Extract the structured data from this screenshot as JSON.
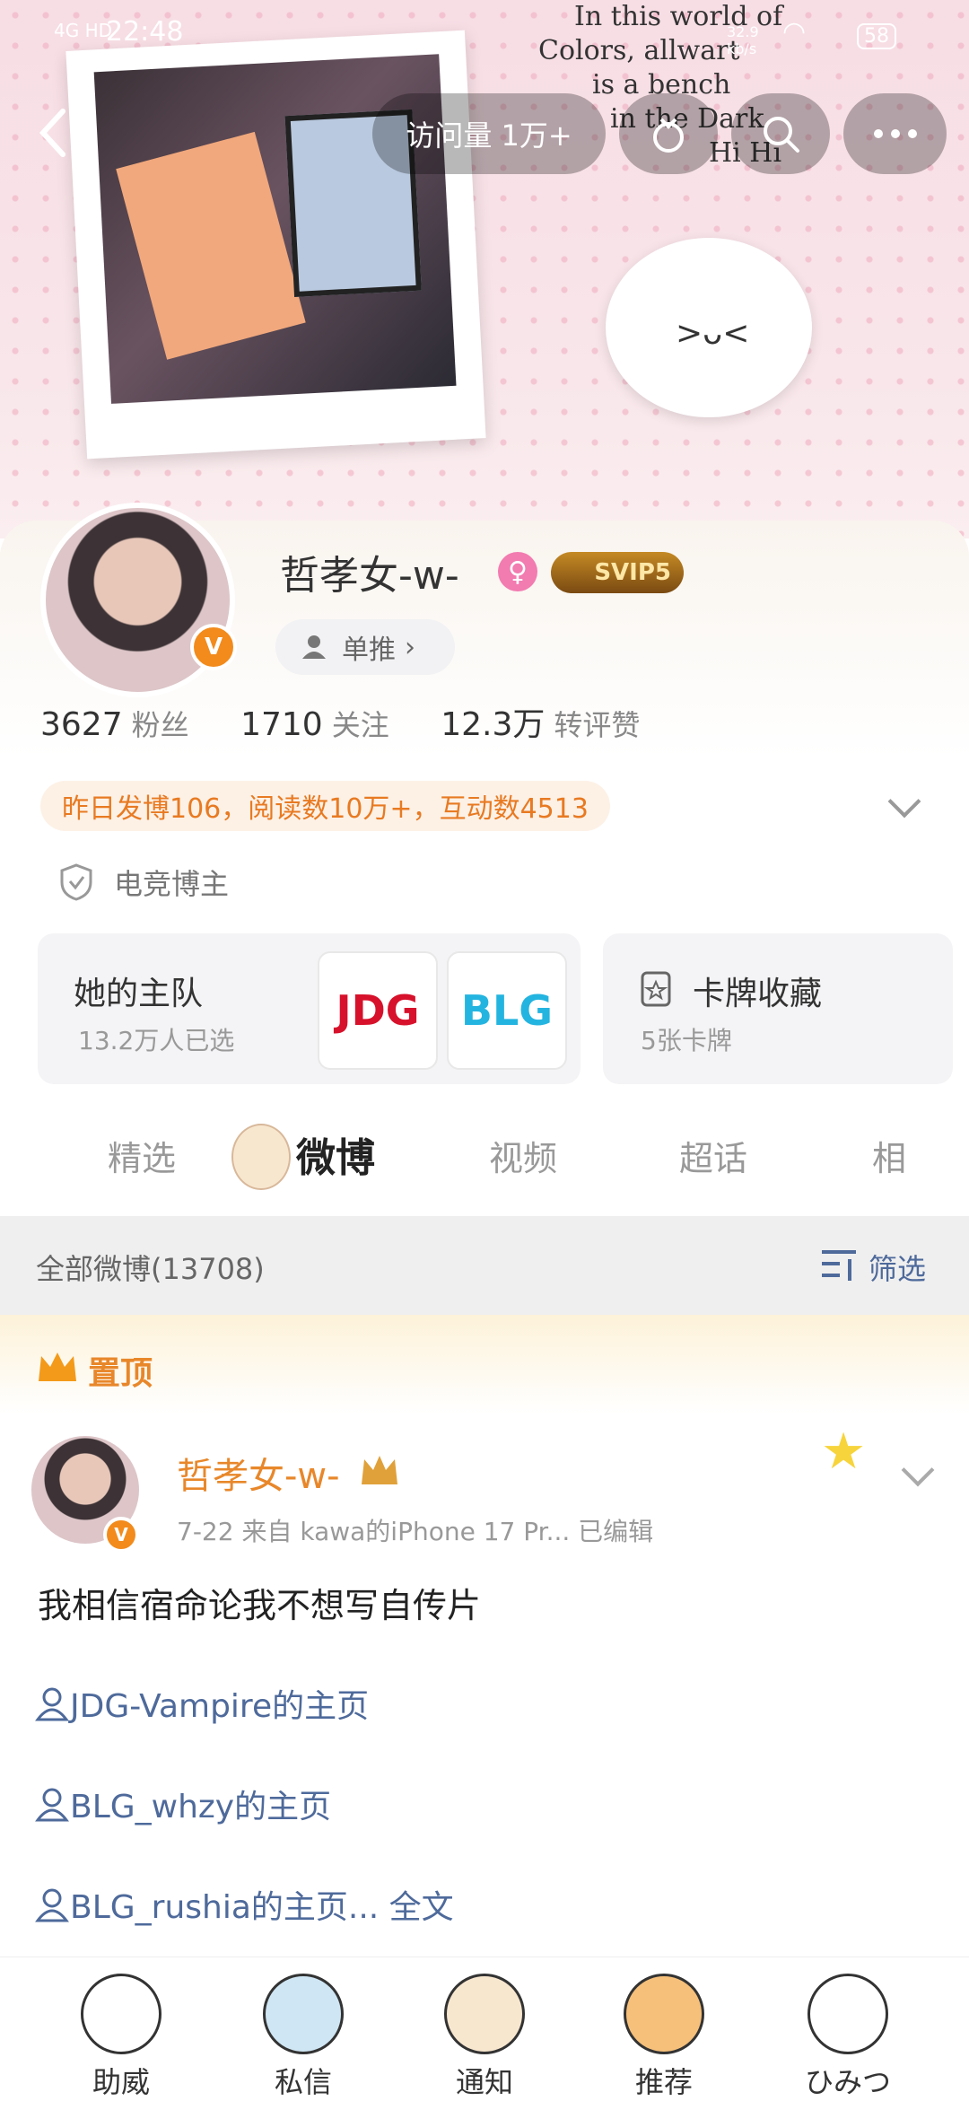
{
  "status_bar": {
    "network": "4G HD",
    "time": "22:48",
    "speed": "32.9 kb/s",
    "battery": "58"
  },
  "header": {
    "visits": "访问量 1万+"
  },
  "sticker_text": [
    "In this world of",
    "Colors, allwart",
    "is a bench",
    "in the Dark",
    "Hi Hi"
  ],
  "profile": {
    "name": "哲孝女-w-",
    "gender_glyph": "♀",
    "vip": "SVIP5",
    "status_pill": "单推",
    "verified": "V",
    "stats": [
      {
        "value": "3627",
        "label": "粉丝"
      },
      {
        "value": "1710",
        "label": "关注"
      },
      {
        "value": "12.3万",
        "label": "转评赞"
      }
    ],
    "today": "昨日发博106，阅读数10万+，互动数4513",
    "cert": "电竞博主"
  },
  "team_box": {
    "title": "她的主队",
    "sub": "13.2万人已选",
    "logos": [
      "JDG",
      "BLG"
    ]
  },
  "cards_box": {
    "title": "卡牌收藏",
    "sub": "5张卡牌"
  },
  "tabs": [
    "精选",
    "微博",
    "视频",
    "超话",
    "相"
  ],
  "filter": {
    "all": "全部微博(13708)",
    "filter": "筛选"
  },
  "pinned": {
    "label": "置顶"
  },
  "post": {
    "name": "哲孝女-w-",
    "meta": "7-22  来自 kawa的iPhone 17 Pr...  已编辑",
    "text": "我相信宿命论我不想写自传片",
    "links": [
      "JDG-Vampire的主页",
      "BLG_whzy的主页",
      "BLG_rushia的主页... 全文"
    ]
  },
  "nav": [
    "助威",
    "私信",
    "通知",
    "推荐",
    "ひみつ"
  ],
  "colors": {
    "accent": "#e8872a",
    "link": "#4e6a9b",
    "vip": "#c58a24"
  }
}
